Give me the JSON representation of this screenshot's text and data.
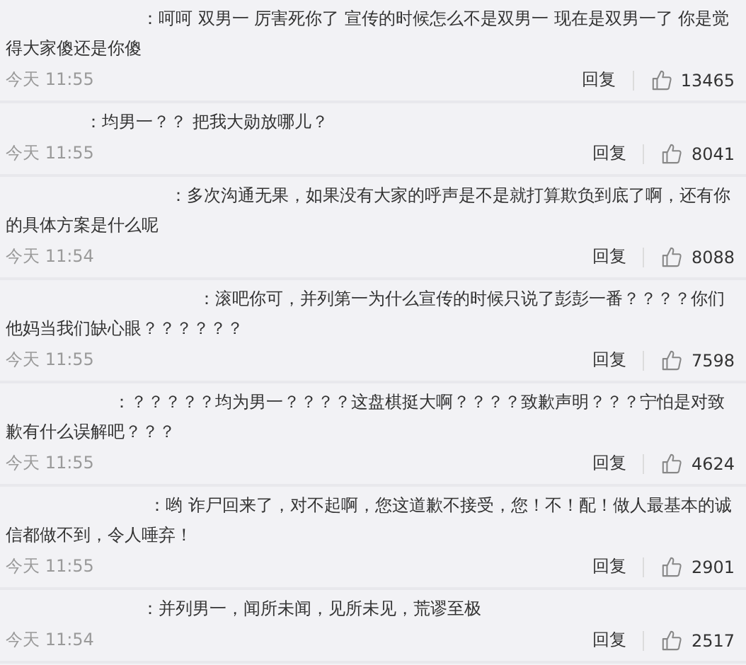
{
  "comments": [
    {
      "text": "：呵呵  双男一  厉害死你了  宣传的时候怎么不是双男一  现在是双男一了  你是觉得大家傻还是你傻",
      "time": "今天 11:55",
      "reply": "回复",
      "likes": "13465"
    },
    {
      "text": "：均男一？？ 把我大勋放哪儿？",
      "time": "今天 11:55",
      "reply": "回复",
      "likes": "8041"
    },
    {
      "text": "：多次沟通无果，如果没有大家的呼声是不是就打算欺负到底了啊，还有你的具体方案是什么呢",
      "time": "今天 11:54",
      "reply": "回复",
      "likes": "8088"
    },
    {
      "text": "：滚吧你可，并列第一为什么宣传的时候只说了彭彭一番？？？？你们他妈当我们缺心眼？？？？？？",
      "time": "今天 11:55",
      "reply": "回复",
      "likes": "7598"
    },
    {
      "text": "：？？？？？均为男一？？？？这盘棋挺大啊？？？？致歉声明？？？宁怕是对致歉有什么误解吧？？？",
      "time": "今天 11:55",
      "reply": "回复",
      "likes": "4624"
    },
    {
      "text": "：哟 诈尸回来了，对不起啊，您这道歉不接受，您！不！配！做人最基本的诚信都做不到，令人唾弃！",
      "time": "今天 11:55",
      "reply": "回复",
      "likes": "2901"
    },
    {
      "text": "：并列男一，闻所未闻，见所未见，荒谬至极",
      "time": "今天 11:54",
      "reply": "回复",
      "likes": "2517"
    }
  ]
}
